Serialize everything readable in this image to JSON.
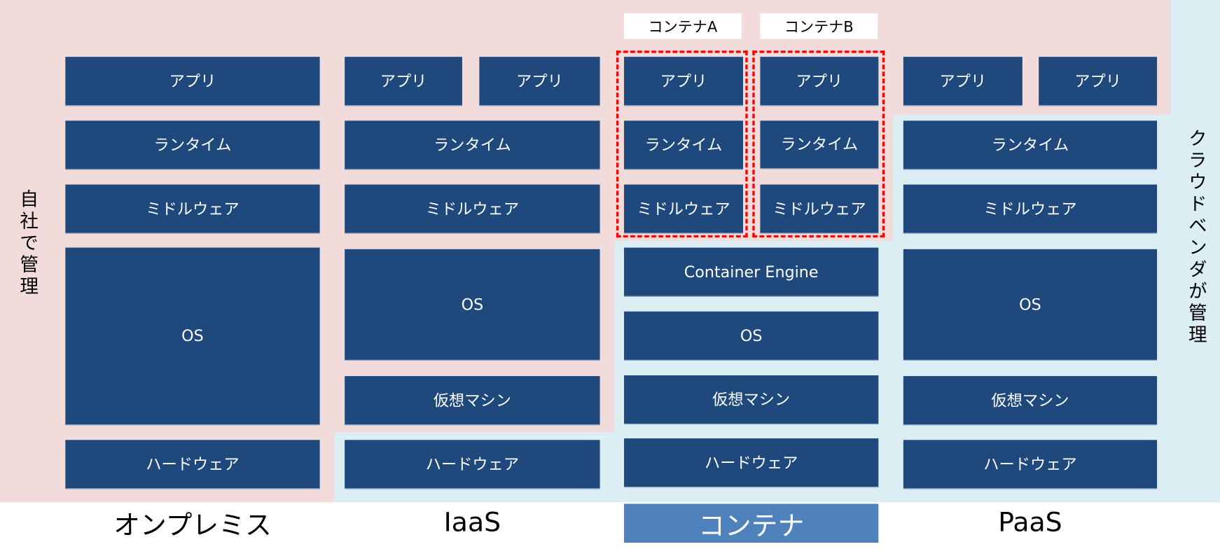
{
  "colors": {
    "self_managed_bg": "#f2dcdb",
    "vendor_managed_bg": "#dbeef4",
    "layer_box": "#1f487c",
    "highlight": "#4f81bd",
    "container_border": "#ff0000"
  },
  "side_labels": {
    "left": "自社で管理",
    "right": "クラウドベンダが管理"
  },
  "container_tags": {
    "a": "コンテナA",
    "b": "コンテナB"
  },
  "columns": {
    "onprem": {
      "label": "オンプレミス",
      "app": "アプリ",
      "runtime": "ランタイム",
      "middleware": "ミドルウェア",
      "os": "OS",
      "hardware": "ハードウェア"
    },
    "iaas": {
      "label": "IaaS",
      "app1": "アプリ",
      "app2": "アプリ",
      "runtime": "ランタイム",
      "middleware": "ミドルウェア",
      "os": "OS",
      "vm": "仮想マシン",
      "hardware": "ハードウェア"
    },
    "container": {
      "label": "コンテナ",
      "a_app": "アプリ",
      "a_runtime": "ランタイム",
      "a_middleware": "ミドルウェア",
      "b_app": "アプリ",
      "b_runtime": "ランタイム",
      "b_middleware": "ミドルウェア",
      "engine": "Container Engine",
      "os": "OS",
      "vm": "仮想マシン",
      "hardware": "ハードウェア"
    },
    "paas": {
      "label": "PaaS",
      "app1": "アプリ",
      "app2": "アプリ",
      "runtime": "ランタイム",
      "middleware": "ミドルウェア",
      "os": "OS",
      "vm": "仮想マシン",
      "hardware": "ハードウェア"
    }
  }
}
